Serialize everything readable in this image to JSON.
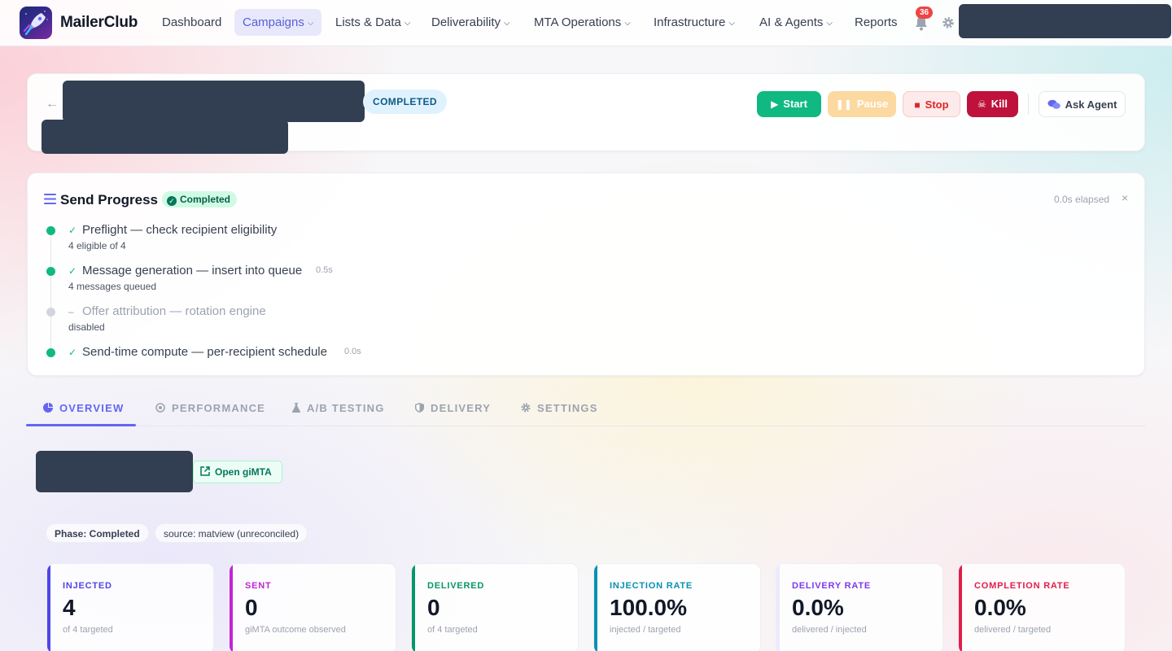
{
  "nav": {
    "brand": "MailerClub",
    "items": [
      {
        "label": "Dashboard"
      },
      {
        "label": "Campaigns"
      },
      {
        "label": "Lists & Data"
      },
      {
        "label": "Deliverability"
      },
      {
        "label": "MTA Operations"
      },
      {
        "label": "Infrastructure"
      },
      {
        "label": "AI & Agents"
      },
      {
        "label": "Reports"
      }
    ],
    "chevron": "⌵",
    "notification_count": "36",
    "icons": {
      "bell": "bell-icon",
      "gear": "gear-icon"
    }
  },
  "campaign": {
    "status": "COMPLETED",
    "back_icon": "←",
    "actions": {
      "start": "Start",
      "pause": "Pause",
      "stop": "Stop",
      "kill": "Kill",
      "ask_agent": "Ask Agent"
    }
  },
  "progress": {
    "title": "Send Progress",
    "status": "Completed",
    "elapsed": "0.0s elapsed",
    "close": "×",
    "steps": [
      {
        "mark": "✓",
        "title": "Preflight — check recipient eligibility",
        "time": "",
        "sub": "4 eligible of 4"
      },
      {
        "mark": "✓",
        "title": "Message generation — insert into queue",
        "time": "0.5s",
        "sub": "4 messages queued"
      },
      {
        "mark": "–",
        "title": "Offer attribution — rotation engine",
        "time": "",
        "sub": "disabled"
      },
      {
        "mark": "✓",
        "title": "Send-time compute — per-recipient schedule",
        "time": "0.0s",
        "sub": ""
      }
    ]
  },
  "tabs": [
    {
      "label": "OVERVIEW",
      "icon": "pie-chart-icon"
    },
    {
      "label": "PERFORMANCE",
      "icon": "target-icon"
    },
    {
      "label": "A/B TESTING",
      "icon": "flask-icon"
    },
    {
      "label": "DELIVERY",
      "icon": "shield-icon"
    },
    {
      "label": "SETTINGS",
      "icon": "gear-icon"
    }
  ],
  "overview": {
    "open_button": "Open giMTA",
    "chips": [
      "Phase: Completed",
      "source: matview (unreconciled)"
    ],
    "stats": [
      {
        "label": "INJECTED",
        "value": "4",
        "sub": "of 4 targeted",
        "color": "#4f46e5"
      },
      {
        "label": "SENT",
        "value": "0",
        "sub": "giMTA outcome observed",
        "color": "#c026d3"
      },
      {
        "label": "DELIVERED",
        "value": "0",
        "sub": "of 4 targeted",
        "color": "#059669"
      },
      {
        "label": "INJECTION RATE",
        "value": "100.0%",
        "sub": "injected / targeted",
        "color": "#0891b2"
      },
      {
        "label": "DELIVERY RATE",
        "value": "0.0%",
        "sub": "delivered / injected",
        "color": "#7c3aed"
      },
      {
        "label": "COMPLETION RATE",
        "value": "0.0%",
        "sub": "delivered / targeted",
        "color": "#e11d48"
      }
    ]
  }
}
